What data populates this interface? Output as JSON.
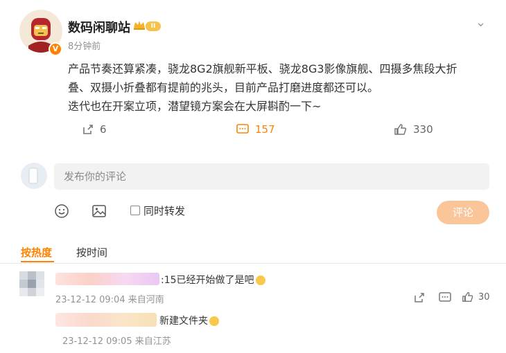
{
  "post": {
    "username": "数码闲聊站",
    "level_badge": "II",
    "verified_badge": "V",
    "time": "8分钟前",
    "body_line1": "产品节奏还算紧凑，骁龙8G2旗舰新平板、骁龙8G3影像旗舰、四摄多焦段大折",
    "body_line2": "叠、双摄小折叠都有提前的兆头，目前产品打磨进度都还可以。",
    "body_line3": "迭代也在开案立项，潜望镜方案会在大屏斟酌一下~",
    "reposts": "6",
    "comments": "157",
    "likes": "330"
  },
  "composer": {
    "placeholder": "发布你的评论",
    "forward_label": "同时转发",
    "submit_label": "评论"
  },
  "sort": {
    "hot": "按热度",
    "time": "按时间"
  },
  "comments": [
    {
      "text": ":15已经开始做了是吧",
      "time": "23-12-12 09:04 来自河南",
      "likes": "30"
    },
    {
      "text": "新建文件夹",
      "time": "23-12-12 09:05 来自江苏"
    }
  ],
  "colors": {
    "accent": "#ff8200",
    "submit_bg": "#fbc59a"
  }
}
